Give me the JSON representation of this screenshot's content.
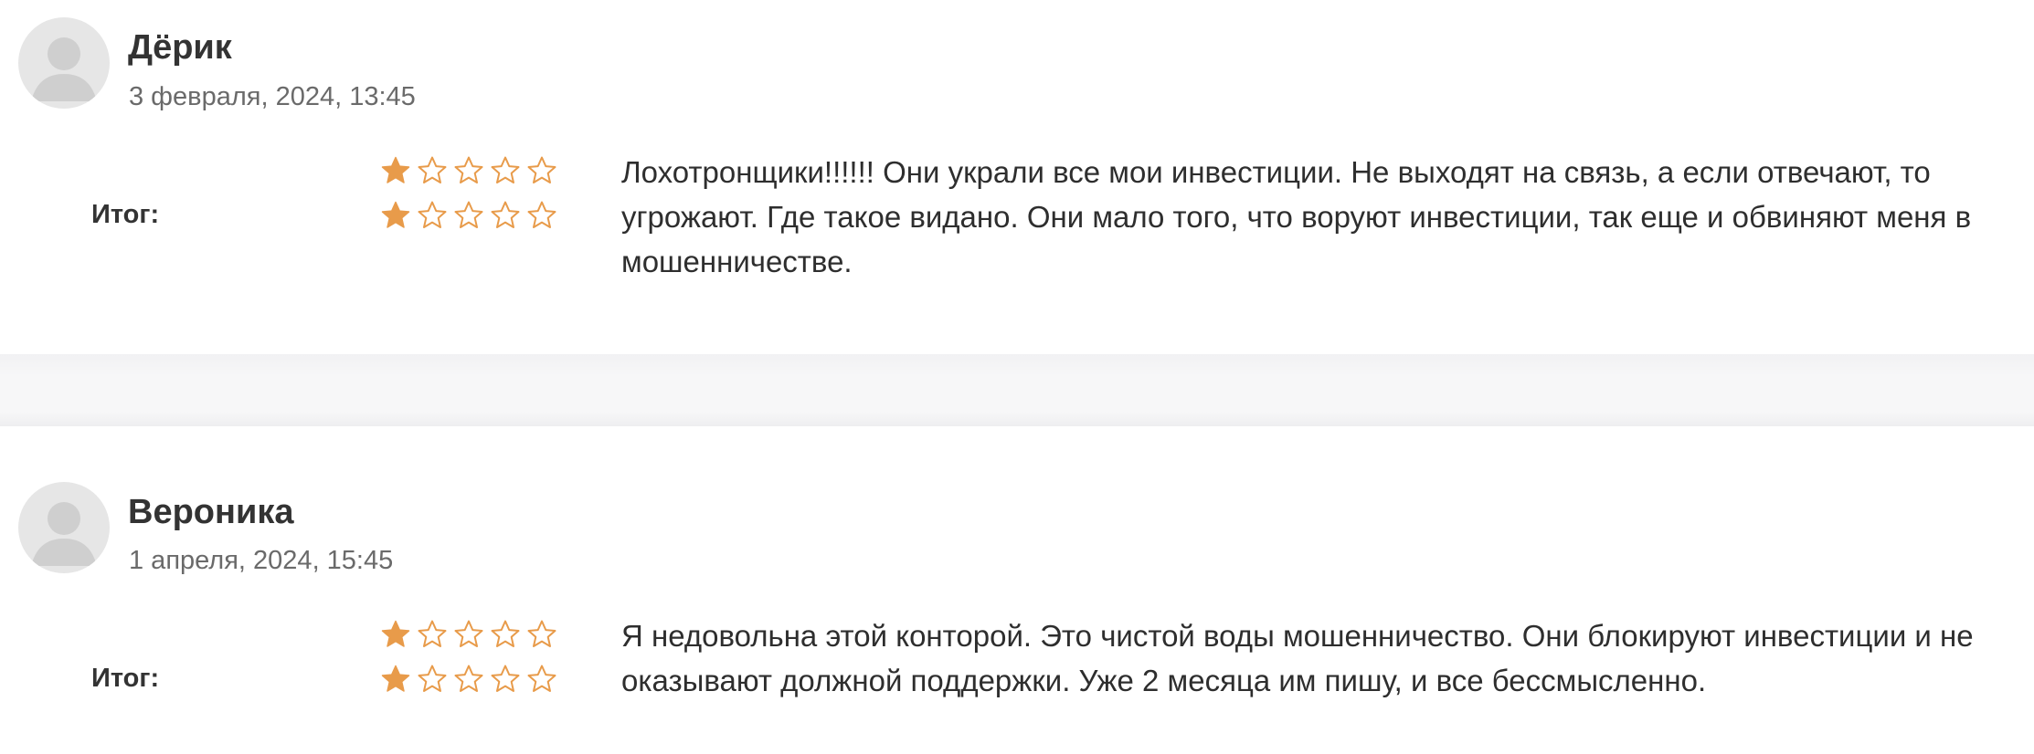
{
  "reviews": [
    {
      "author": "Дёрик",
      "date": "3 февраля, 2024, 13:45",
      "rating_rows": [
        {
          "rating": 1,
          "max": 5
        },
        {
          "rating": 1,
          "max": 5
        }
      ],
      "total_label": "Итог:",
      "text": "Лохотронщики!!!!!! Они украли все мои инвестиции. Не выходят на связь, а если отвечают, то угрожают. Где такое видано. Они мало того, что воруют инвестиции, так еще и обвиняют меня в мошенничестве."
    },
    {
      "author": "Вероника",
      "date": "1 апреля, 2024, 15:45",
      "rating_rows": [
        {
          "rating": 1,
          "max": 5
        },
        {
          "rating": 1,
          "max": 5
        }
      ],
      "total_label": "Итог:",
      "text": "Я недовольна этой конторой. Это чистой воды мошенничество. Они блокируют инвестиции и не оказывают должной поддержки. Уже 2 месяца им пишу, и все бессмысленно."
    }
  ],
  "colors": {
    "star_filled": "#e89b4a",
    "star_outline": "#e89b4a",
    "avatar_bg": "#e6e6e6",
    "avatar_fg": "#cfcfcf"
  },
  "icons": {
    "avatar": "user-placeholder-icon",
    "star_filled": "star-filled-icon",
    "star_empty": "star-outline-icon"
  }
}
